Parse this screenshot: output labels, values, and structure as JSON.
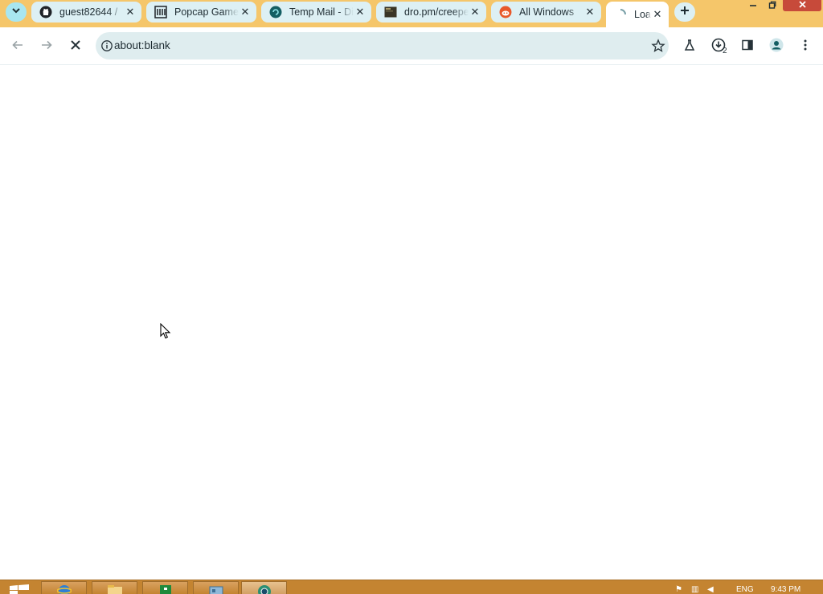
{
  "tabs": [
    {
      "title": "guest82644 / ",
      "favicon": "github-icon"
    },
    {
      "title": "Popcap Games",
      "favicon": "archive-icon"
    },
    {
      "title": "Temp Mail - Disposable",
      "favicon": "tempmail-icon"
    },
    {
      "title": "dro.pm/creeper",
      "favicon": "terminal-icon"
    },
    {
      "title": "All Windows",
      "favicon": "reddit-icon"
    },
    {
      "title": "Loading",
      "favicon": "loading-icon",
      "active": true
    }
  ],
  "omnibox": {
    "url": "about:blank"
  },
  "toolbar": {
    "downloads_count": "2"
  },
  "taskbar": {
    "language": "ENG",
    "time": "9:43 PM"
  },
  "colors": {
    "tabstrip": "#f5c66a",
    "tab": "#ddf0f4",
    "omnibox": "#dfedef",
    "taskbar": "#c48431",
    "window_close": "#c74a3a"
  }
}
